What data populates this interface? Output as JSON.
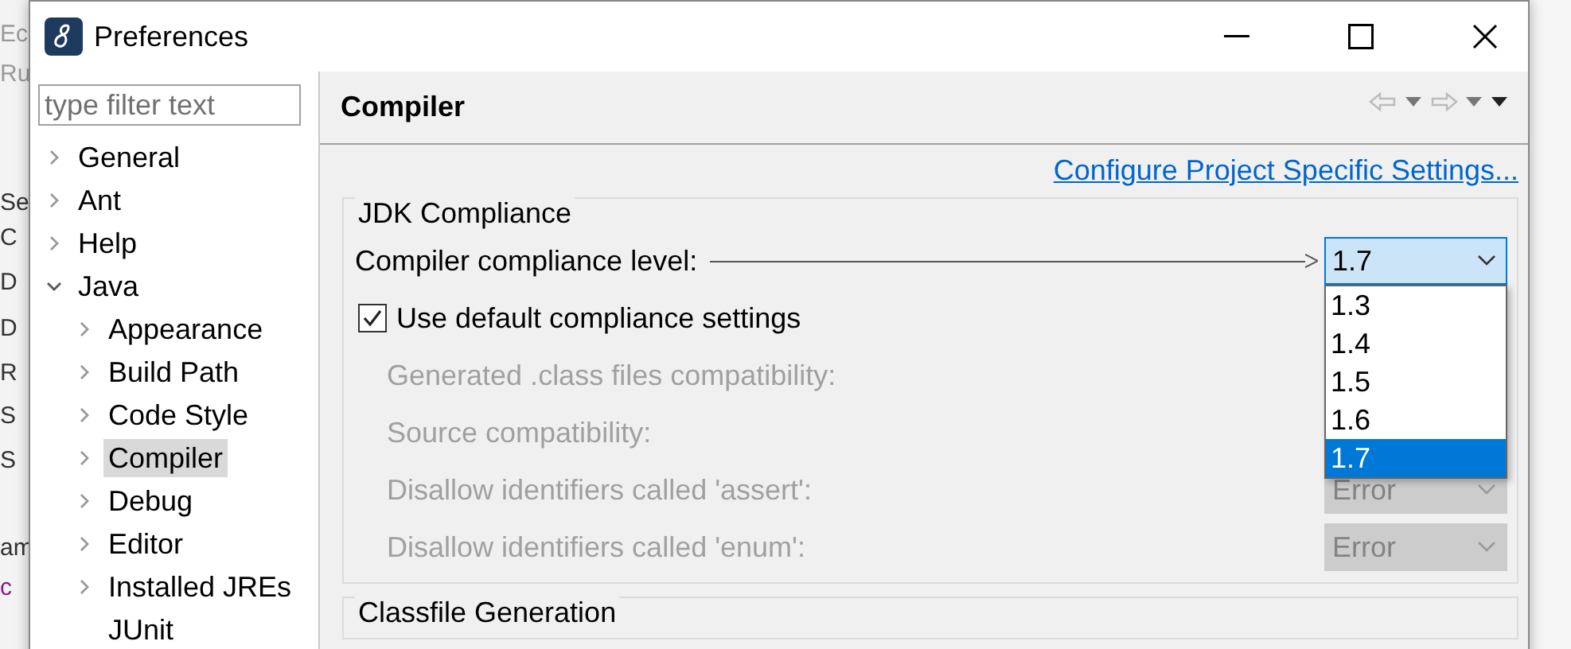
{
  "background_window": {
    "fragments": [
      "Ec",
      "Ru",
      "Se",
      "C",
      "D",
      "D",
      "R",
      "S",
      "S",
      "am",
      "c"
    ]
  },
  "dialog": {
    "title": "Preferences"
  },
  "filter": {
    "placeholder": "type filter text"
  },
  "tree": [
    {
      "label": "General",
      "kind": "folder",
      "expanded": false,
      "selected": false
    },
    {
      "label": "Ant",
      "kind": "folder",
      "expanded": false,
      "selected": false
    },
    {
      "label": "Help",
      "kind": "folder",
      "expanded": false,
      "selected": false
    },
    {
      "label": "Java",
      "kind": "folder",
      "expanded": true,
      "selected": false,
      "children": [
        {
          "label": "Appearance",
          "kind": "folder",
          "expanded": false,
          "selected": false
        },
        {
          "label": "Build Path",
          "kind": "folder",
          "expanded": false,
          "selected": false
        },
        {
          "label": "Code Style",
          "kind": "folder",
          "expanded": false,
          "selected": false
        },
        {
          "label": "Compiler",
          "kind": "folder",
          "expanded": false,
          "selected": true
        },
        {
          "label": "Debug",
          "kind": "folder",
          "expanded": false,
          "selected": false
        },
        {
          "label": "Editor",
          "kind": "folder",
          "expanded": false,
          "selected": false
        },
        {
          "label": "Installed JREs",
          "kind": "folder",
          "expanded": false,
          "selected": false
        },
        {
          "label": "JUnit",
          "kind": "leaf",
          "selected": false
        }
      ]
    }
  ],
  "page": {
    "title": "Compiler",
    "link": "Configure Project Specific Settings...",
    "groups": [
      {
        "title": "JDK Compliance",
        "rows": [
          {
            "kind": "combo",
            "label": "Compiler compliance level:",
            "value": "1.7",
            "disabled": false,
            "leader": true,
            "open": true,
            "options": [
              {
                "label": "1.3",
                "selected": false
              },
              {
                "label": "1.4",
                "selected": false
              },
              {
                "label": "1.5",
                "selected": false
              },
              {
                "label": "1.6",
                "selected": false
              },
              {
                "label": "1.7",
                "selected": true
              }
            ]
          },
          {
            "kind": "checkbox",
            "label": "Use default compliance settings",
            "checked": true
          },
          {
            "kind": "label",
            "label": "Generated .class files compatibility:",
            "disabled": true
          },
          {
            "kind": "label",
            "label": "Source compatibility:",
            "disabled": true
          },
          {
            "kind": "combo",
            "label": "Disallow identifiers called 'assert':",
            "value": "Error",
            "disabled": true
          },
          {
            "kind": "combo",
            "label": "Disallow identifiers called 'enum':",
            "value": "Error",
            "disabled": true
          }
        ]
      },
      {
        "title": "Classfile Generation"
      }
    ]
  }
}
